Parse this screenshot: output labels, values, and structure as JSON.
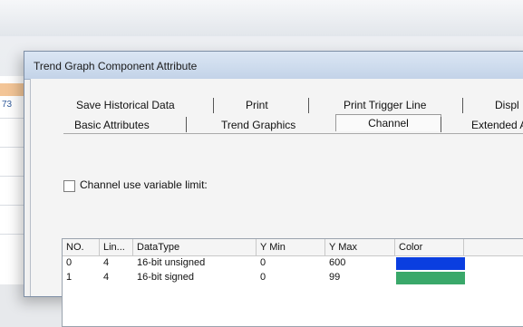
{
  "dialog": {
    "title": "Trend Graph Component Attribute"
  },
  "tabs": {
    "row1": [
      {
        "label": "Save Historical Data"
      },
      {
        "label": "Print"
      },
      {
        "label": "Print Trigger Line"
      },
      {
        "label": "Displ"
      }
    ],
    "row2": [
      {
        "label": "Basic Attributes"
      },
      {
        "label": "Trend Graphics"
      },
      {
        "label": "Channel",
        "active": true
      },
      {
        "label": "Extended A"
      }
    ]
  },
  "channel_options": {
    "variable_limit_label": "Channel use variable limit:",
    "variable_limit_checked": false
  },
  "table": {
    "columns": [
      "NO.",
      "Lin...",
      "DataType",
      "Y Min",
      "Y Max",
      "Color"
    ],
    "rows": [
      {
        "no": "0",
        "lin": "4",
        "datatype": "16-bit unsigned",
        "ymin": "0",
        "ymax": "600",
        "color": "#0a3ee0"
      },
      {
        "no": "1",
        "lin": "4",
        "datatype": "16-bit signed",
        "ymin": "0",
        "ymax": "99",
        "color": "#3aa86a"
      }
    ]
  },
  "background": {
    "side_label": "73"
  }
}
